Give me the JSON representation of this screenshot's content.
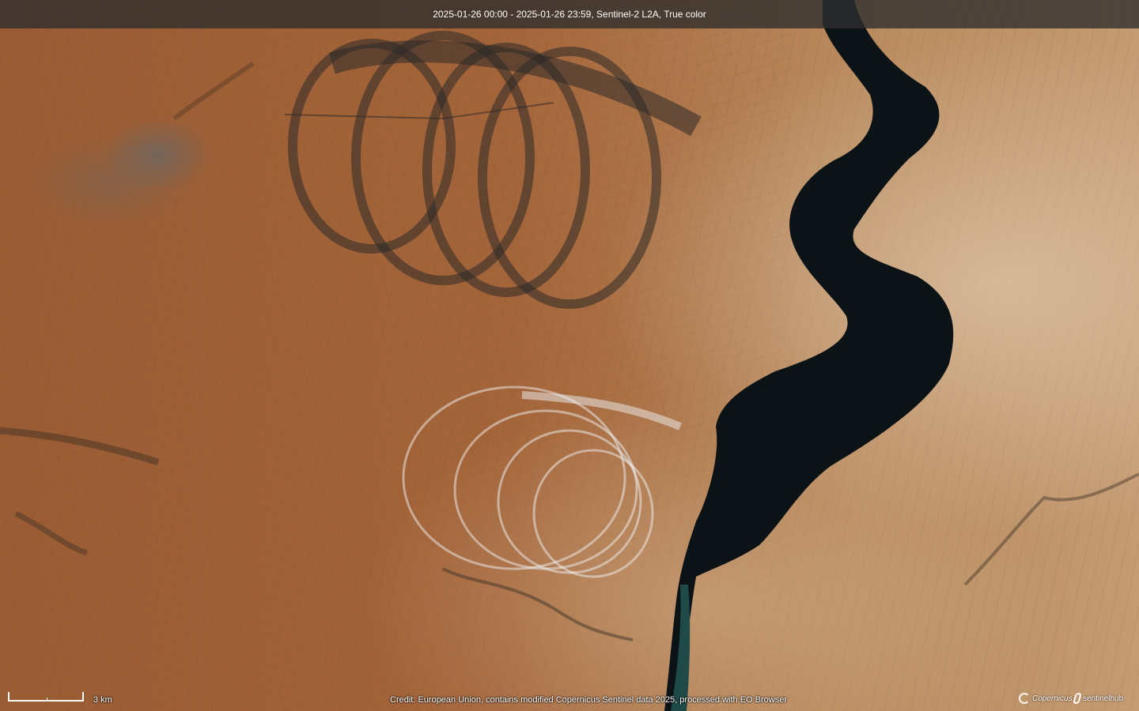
{
  "header": {
    "title": "2025-01-26 00:00 - 2025-01-26 23:59, Sentinel-2 L2A, True color"
  },
  "scale": {
    "label": "3 km"
  },
  "footer": {
    "credit": "Credit: European Union, contains modified Copernicus Sentinel data 2025, processed with EO Browser",
    "logos": [
      "Copernicus",
      "sentinelhub"
    ]
  },
  "colors": {
    "terrain": "#a8683a",
    "terrain_light": "#c79868",
    "water": "#0a1216",
    "header_bg": "#2d2d2d"
  }
}
